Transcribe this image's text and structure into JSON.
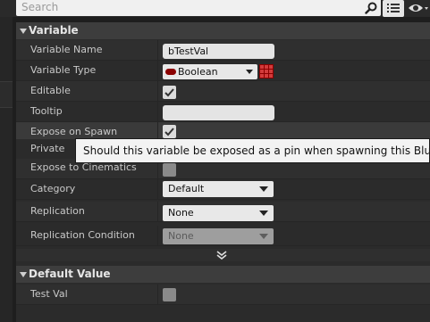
{
  "search": {
    "placeholder": "Search"
  },
  "icons": {
    "search": "magnifier-icon",
    "view_options": "view-options-icon",
    "visibility": "eye-icon",
    "expand": "chevron-down-icon"
  },
  "colors": {
    "panel_bg": "#2b2b2b",
    "header_bg": "#3d3d3d",
    "boolean_pin": "#8b0000"
  },
  "variable_section": {
    "title": "Variable",
    "rows": {
      "name": {
        "label": "Variable Name",
        "value": "bTestVal"
      },
      "type": {
        "label": "Variable Type",
        "value": "Boolean"
      },
      "editable": {
        "label": "Editable",
        "checked": true
      },
      "tooltip": {
        "label": "Tooltip",
        "value": ""
      },
      "expose_on_spawn": {
        "label": "Expose on Spawn",
        "checked": true
      },
      "private": {
        "label": "Private"
      },
      "expose_cinematics": {
        "label": "Expose to Cinematics",
        "checked": false
      },
      "category": {
        "label": "Category",
        "value": "Default"
      },
      "replication": {
        "label": "Replication",
        "value": "None"
      },
      "replication_condition": {
        "label": "Replication Condition",
        "value": "None",
        "enabled": false
      }
    }
  },
  "default_section": {
    "title": "Default Value",
    "rows": {
      "test_val": {
        "label": "Test Val",
        "checked": false
      }
    }
  },
  "tooltip": {
    "text": "Should this variable be exposed as a pin when spawning this Blueprint?"
  }
}
